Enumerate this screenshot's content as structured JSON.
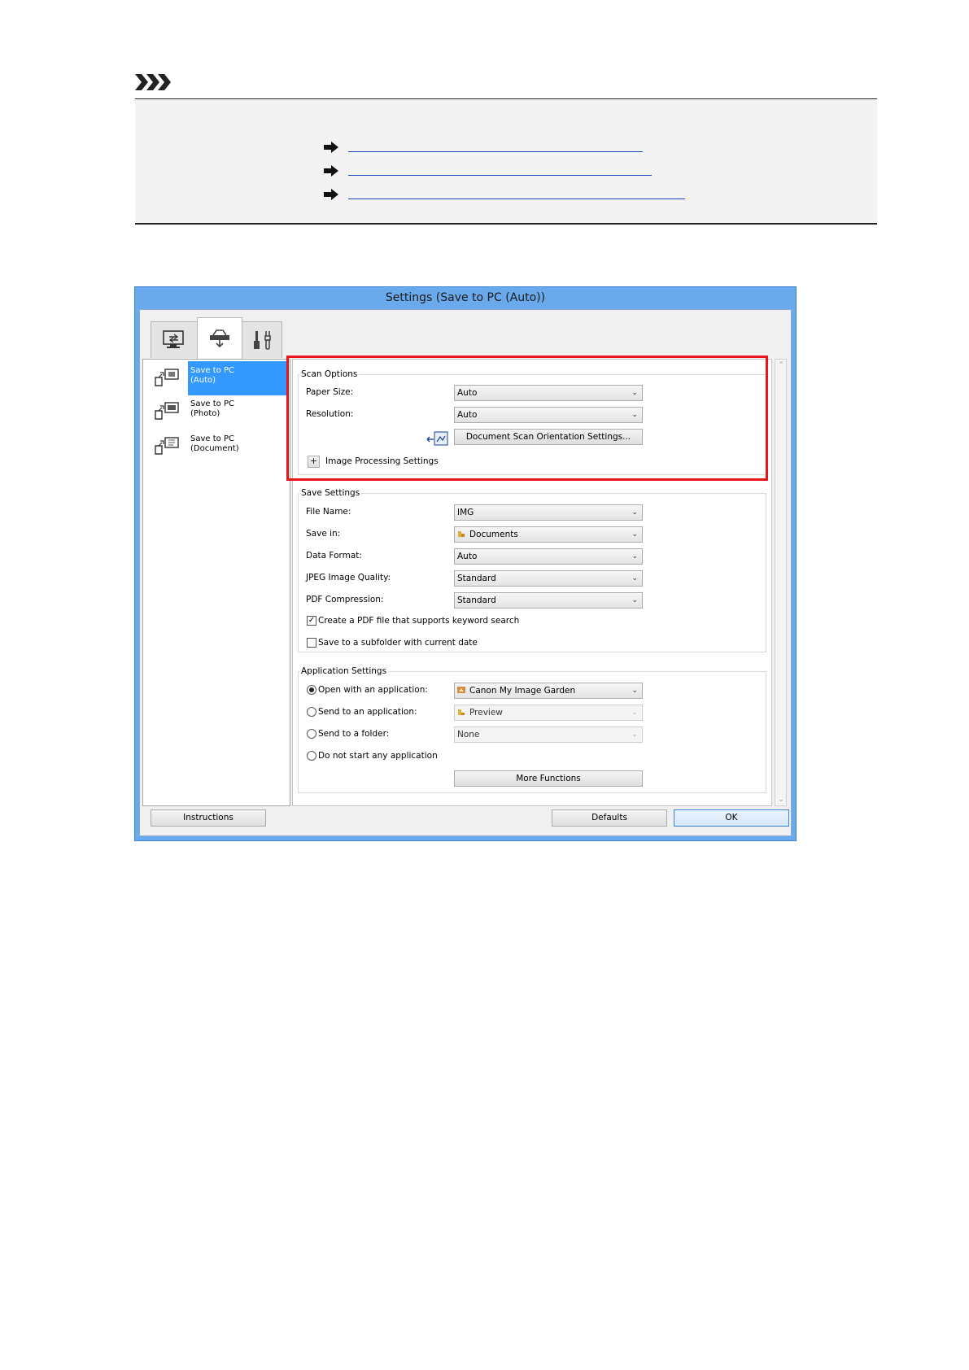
{
  "colors": {
    "link": "#1a3fc0",
    "highlight": "#e8141c",
    "selection": "#3399ff",
    "title_bar": "#6aa9ec"
  },
  "note": {
    "icon": "note-chevrons-icon",
    "links": [
      {
        "icon": "arrow-right-icon"
      },
      {
        "icon": "arrow-right-icon"
      },
      {
        "icon": "arrow-right-icon"
      }
    ]
  },
  "dialog": {
    "title": "Settings (Save to PC (Auto))",
    "tabs": [
      {
        "icon": "scan-from-computer-icon",
        "active": false
      },
      {
        "icon": "scan-from-operation-panel-icon",
        "active": true
      },
      {
        "icon": "general-settings-icon",
        "active": false
      }
    ],
    "side_items": [
      {
        "label": "Save to PC\n(Auto)",
        "selected": true
      },
      {
        "label": "Save to PC\n(Photo)",
        "selected": false
      },
      {
        "label": "Save to PC\n(Document)",
        "selected": false
      }
    ],
    "scan_options": {
      "title": "Scan Options",
      "paper_size_label": "Paper Size:",
      "paper_size_value": "Auto",
      "resolution_label": "Resolution:",
      "resolution_value": "Auto",
      "orientation_button": "Document Scan Orientation Settings...",
      "image_processing_label": "Image Processing Settings",
      "expand_symbol": "+"
    },
    "save_settings": {
      "title": "Save Settings",
      "file_name_label": "File Name:",
      "file_name_value": "IMG",
      "save_in_label": "Save in:",
      "save_in_value": "Documents",
      "data_format_label": "Data Format:",
      "data_format_value": "Auto",
      "jpeg_quality_label": "JPEG Image Quality:",
      "jpeg_quality_value": "Standard",
      "pdf_compression_label": "PDF Compression:",
      "pdf_compression_value": "Standard",
      "keyword_search_label": "Create a PDF file that supports keyword search",
      "keyword_search_checked": true,
      "subfolder_label": "Save to a subfolder with current date",
      "subfolder_checked": false
    },
    "application_settings": {
      "title": "Application Settings",
      "open_with_label": "Open with an application:",
      "open_with_value": "Canon My Image Garden",
      "send_to_app_label": "Send to an application:",
      "send_to_app_value": "Preview",
      "send_to_folder_label": "Send to a folder:",
      "send_to_folder_value": "None",
      "no_app_label": "Do not start any application",
      "selected_option": "open_with",
      "more_functions_button": "More Functions"
    },
    "footer": {
      "instructions_button": "Instructions",
      "defaults_button": "Defaults",
      "ok_button": "OK"
    }
  }
}
